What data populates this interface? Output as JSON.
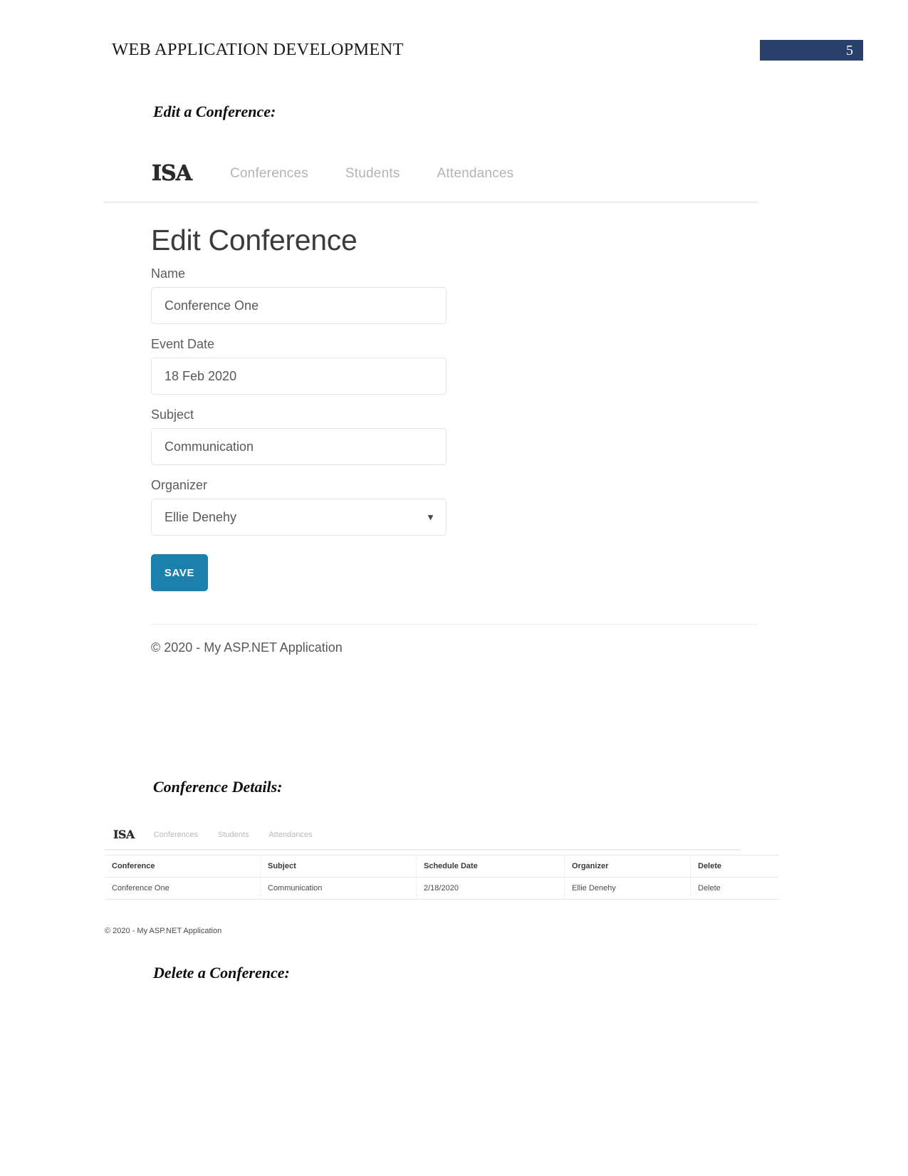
{
  "document": {
    "header_title": "WEB APPLICATION DEVELOPMENT",
    "page_number": "5",
    "accent_color": "#28406b"
  },
  "captions": {
    "edit": "Edit a Conference:",
    "details": "Conference Details:",
    "delete": "Delete a Conference:"
  },
  "edit_screenshot": {
    "navbar": {
      "brand": "ISA",
      "links": [
        {
          "label": "Conferences"
        },
        {
          "label": "Students"
        },
        {
          "label": "Attendances"
        }
      ]
    },
    "page_title": "Edit Conference",
    "fields": [
      {
        "label": "Name",
        "value": "Conference One"
      },
      {
        "label": "Event Date",
        "value": "18 Feb 2020"
      },
      {
        "label": "Subject",
        "value": "Communication"
      }
    ],
    "organizer": {
      "label": "Organizer",
      "value": "Ellie Denehy",
      "arrow_icon": "chevron-down-icon"
    },
    "save_label": "SAVE",
    "save_color": "#1b81ac",
    "footer": "© 2020 - My ASP.NET Application"
  },
  "details_screenshot": {
    "navbar": {
      "brand": "ISA",
      "links": [
        {
          "label": "Conferences"
        },
        {
          "label": "Students"
        },
        {
          "label": "Attendances"
        }
      ]
    },
    "table": {
      "columns": [
        "Conference",
        "Subject",
        "Schedule Date",
        "Organizer",
        "Delete"
      ],
      "rows": [
        {
          "conference": "Conference One",
          "subject": "Communication",
          "schedule_date": "2/18/2020",
          "organizer": "Ellie Denehy",
          "delete": "Delete"
        }
      ]
    },
    "footer": "© 2020 - My ASP.NET Application"
  }
}
